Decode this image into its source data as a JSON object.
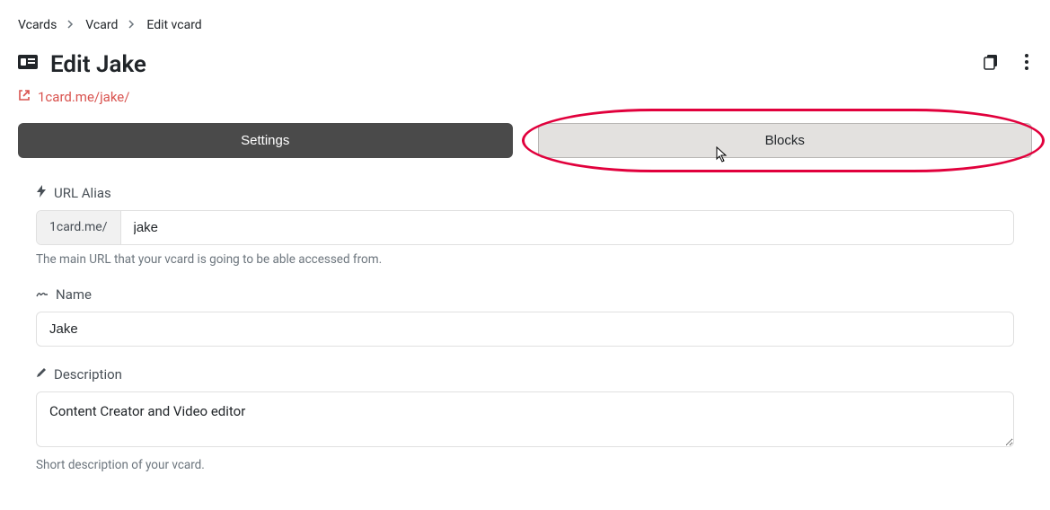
{
  "breadcrumb": {
    "items": [
      "Vcards",
      "Vcard",
      "Edit vcard"
    ]
  },
  "header": {
    "title": "Edit Jake"
  },
  "url": {
    "display": "1card.me/jake/"
  },
  "tabs": {
    "settings": "Settings",
    "blocks": "Blocks"
  },
  "form": {
    "url_alias": {
      "label": "URL Alias",
      "prefix": "1card.me/",
      "value": "jake",
      "help": "The main URL that your vcard is going to be able accessed from."
    },
    "name": {
      "label": "Name",
      "value": "Jake"
    },
    "description": {
      "label": "Description",
      "value": "Content Creator and Video editor",
      "help": "Short description of your vcard."
    }
  }
}
